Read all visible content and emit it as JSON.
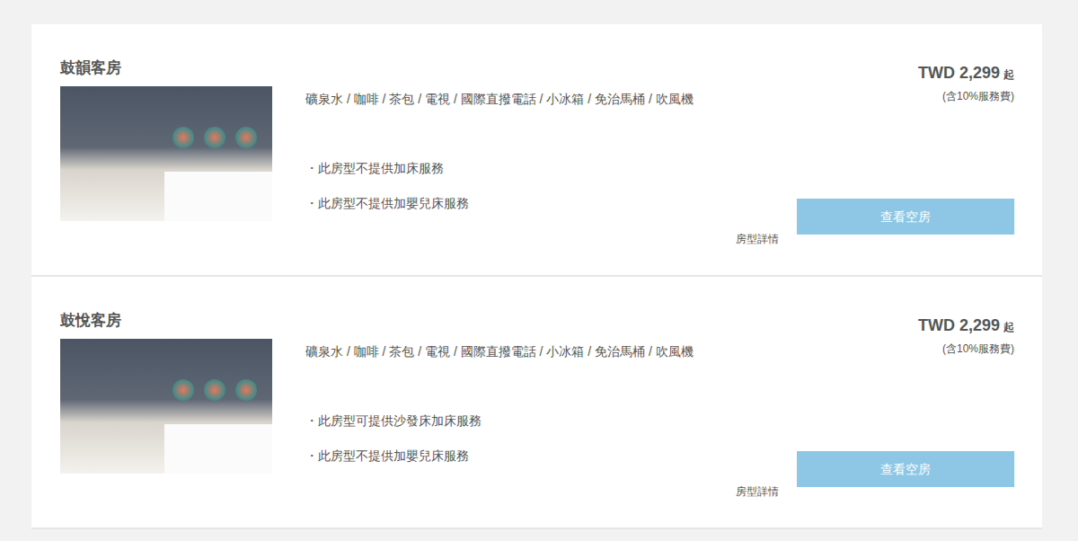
{
  "rooms": [
    {
      "name": "鼓韻客房",
      "amenities": "礦泉水 / 咖啡 / 茶包 / 電視 / 國際直撥電話 / 小冰箱 / 免治馬桶 / 吹風機",
      "notes": [
        "・此房型不提供加床服務",
        "・此房型不提供加嬰兒床服務"
      ],
      "details_link": "房型詳情",
      "price": "TWD 2,299",
      "price_suffix": "起",
      "price_note": "(含10%服務費)",
      "button": "查看空房"
    },
    {
      "name": "鼓悅客房",
      "amenities": "礦泉水 / 咖啡 / 茶包 / 電視 / 國際直撥電話 / 小冰箱 / 免治馬桶 / 吹風機",
      "notes": [
        "・此房型可提供沙發床加床服務",
        "・此房型不提供加嬰兒床服務"
      ],
      "details_link": "房型詳情",
      "price": "TWD 2,299",
      "price_suffix": "起",
      "price_note": "(含10%服務費)",
      "button": "查看空房"
    }
  ]
}
